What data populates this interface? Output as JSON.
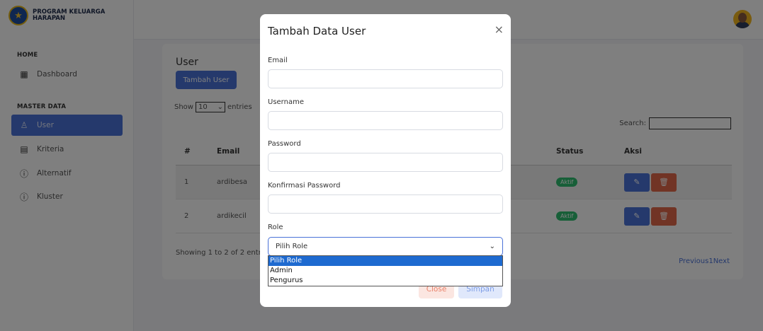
{
  "brand": {
    "name": "PROGRAM KELUARGA HARAPAN"
  },
  "sidebar": {
    "home_section": "HOME",
    "master_section": "MASTER DATA",
    "items": [
      {
        "label": "Dashboard",
        "icon": "dashboard-icon"
      },
      {
        "label": "User",
        "icon": "user-icon",
        "active": true
      },
      {
        "label": "Kriteria",
        "icon": "list-icon"
      },
      {
        "label": "Alternatif",
        "icon": "info-icon"
      },
      {
        "label": "Kluster",
        "icon": "info-icon"
      }
    ]
  },
  "page": {
    "title": "User",
    "add_button": "Tambah User",
    "show_label": "Show",
    "entries_value": "10",
    "entries_label": "entries",
    "search_label": "Search:",
    "columns": [
      "#",
      "Email",
      "Status",
      "Aksi"
    ],
    "rows": [
      {
        "no": "1",
        "email": "ardibesa",
        "status": "Aktif"
      },
      {
        "no": "2",
        "email": "ardikecil",
        "status": "Aktif"
      }
    ],
    "showing": "Showing 1 to 2 of 2 entries",
    "pager": "Previous1Next"
  },
  "modal": {
    "title": "Tambah Data User",
    "close_icon": "×",
    "fields": {
      "email": "Email",
      "username": "Username",
      "password": "Password",
      "confirm": "Konfirmasi Password",
      "role": "Role"
    },
    "role_selected": "Pilih Role",
    "role_options": [
      "Pilih Role",
      "Admin",
      "Pengurus"
    ],
    "close_button": "Close",
    "save_button": "Simpan"
  },
  "colors": {
    "primary": "#4a72d8",
    "danger": "#e2684a",
    "success": "#2fbf71"
  }
}
